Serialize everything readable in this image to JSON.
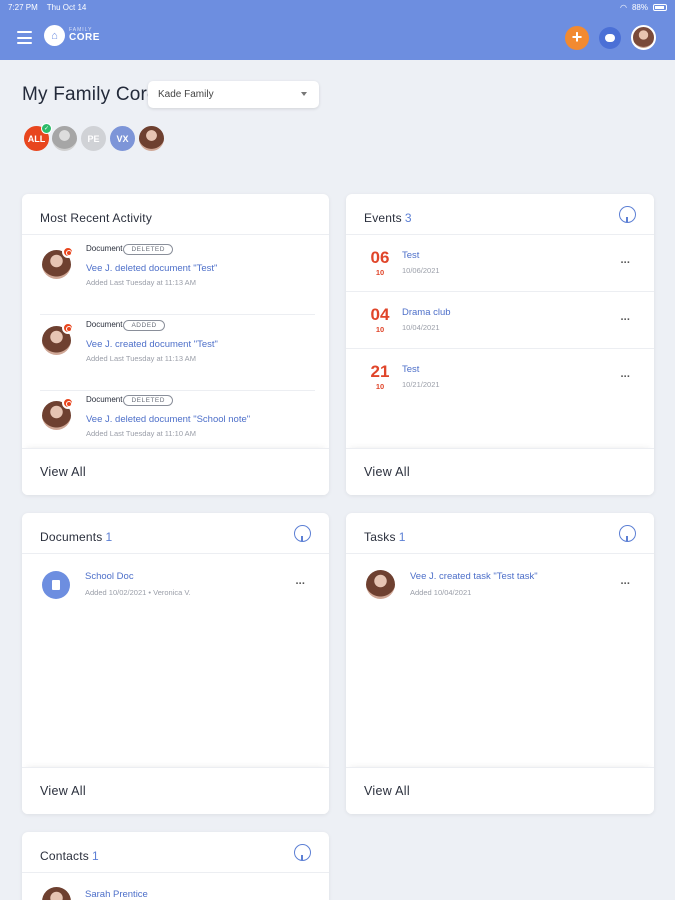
{
  "status_bar": {
    "time": "7:27 PM",
    "date": "Thu Oct 14",
    "battery": "88%"
  },
  "header": {
    "logo_small": "FAMILY",
    "logo_big": "CORE",
    "add_label": "+",
    "menu_icon": "hamburger-icon",
    "chat_icon": "chat-bubble-icon"
  },
  "page": {
    "title": "My Family Core",
    "family_select": "Kade Family"
  },
  "members": [
    {
      "label": "ALL",
      "selected": true
    },
    {
      "label": ""
    },
    {
      "label": "PE"
    },
    {
      "label": "VX"
    },
    {
      "label": ""
    }
  ],
  "recent_activity": {
    "title": "Most Recent Activity",
    "view_all": "View All",
    "items": [
      {
        "type": "Document",
        "tag": "DELETED",
        "title": "Vee J. deleted document \"Test\"",
        "sub": "Added Last Tuesday at 11:13 AM"
      },
      {
        "type": "Document",
        "tag": "ADDED",
        "title": "Vee J. created document \"Test\"",
        "sub": "Added Last Tuesday at 11:13 AM"
      },
      {
        "type": "Document",
        "tag": "DELETED",
        "title": "Vee J. deleted document \"School note\"",
        "sub": "Added Last Tuesday at 11:10 AM"
      }
    ]
  },
  "events": {
    "title": "Events",
    "count": "3",
    "view_all": "View All",
    "items": [
      {
        "day": "06",
        "month": "10",
        "title": "Test",
        "date": "10/06/2021"
      },
      {
        "day": "04",
        "month": "10",
        "title": "Drama club",
        "date": "10/04/2021"
      },
      {
        "day": "21",
        "month": "10",
        "title": "Test",
        "date": "10/21/2021"
      }
    ]
  },
  "documents": {
    "title": "Documents",
    "count": "1",
    "view_all": "View All",
    "items": [
      {
        "title": "School Doc",
        "sub": "Added 10/02/2021 • Veronica V."
      }
    ]
  },
  "tasks": {
    "title": "Tasks",
    "count": "1",
    "view_all": "View All",
    "items": [
      {
        "title": "Vee J. created task \"Test task\"",
        "sub": "Added 10/04/2021"
      }
    ]
  },
  "contacts": {
    "title": "Contacts",
    "count": "1",
    "items": [
      {
        "title": "Sarah Prentice"
      }
    ]
  },
  "more_label": "···",
  "colors": {
    "header": "#6d8ee0",
    "accent": "#4d6fc9",
    "date_red": "#e0452a",
    "add_orange": "#f28a31"
  }
}
